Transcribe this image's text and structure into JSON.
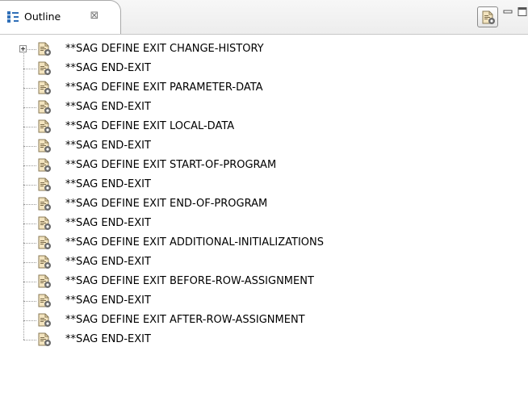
{
  "view": {
    "tab_title": "Outline",
    "close_glyph": "⊠",
    "icons": {
      "tab": "outline-view-icon",
      "toolbar": "hide-fields-icon",
      "minimize": "minimize-icon",
      "maximize": "maximize-icon",
      "tree_item": "natural-source-exit-icon",
      "expander": "plus-expander-icon"
    }
  },
  "tree": {
    "items": [
      {
        "label": "**SAG DEFINE EXIT CHANGE-HISTORY",
        "expandable": true
      },
      {
        "label": "**SAG END-EXIT",
        "expandable": false
      },
      {
        "label": "**SAG DEFINE EXIT PARAMETER-DATA",
        "expandable": false
      },
      {
        "label": "**SAG END-EXIT",
        "expandable": false
      },
      {
        "label": "**SAG DEFINE EXIT LOCAL-DATA",
        "expandable": false
      },
      {
        "label": "**SAG END-EXIT",
        "expandable": false
      },
      {
        "label": "**SAG DEFINE EXIT START-OF-PROGRAM",
        "expandable": false
      },
      {
        "label": "**SAG END-EXIT",
        "expandable": false
      },
      {
        "label": "**SAG DEFINE EXIT END-OF-PROGRAM",
        "expandable": false
      },
      {
        "label": "**SAG END-EXIT",
        "expandable": false
      },
      {
        "label": "**SAG DEFINE EXIT ADDITIONAL-INITIALIZATIONS",
        "expandable": false
      },
      {
        "label": "**SAG END-EXIT",
        "expandable": false
      },
      {
        "label": "**SAG DEFINE EXIT BEFORE-ROW-ASSIGNMENT",
        "expandable": false
      },
      {
        "label": "**SAG END-EXIT",
        "expandable": false
      },
      {
        "label": "**SAG DEFINE EXIT AFTER-ROW-ASSIGNMENT",
        "expandable": false
      },
      {
        "label": "**SAG END-EXIT",
        "expandable": false
      }
    ]
  },
  "colors": {
    "accent_blue": "#2f6fb8",
    "doc_tan": "#e7c98a",
    "gear_gray": "#6b6b6b"
  }
}
